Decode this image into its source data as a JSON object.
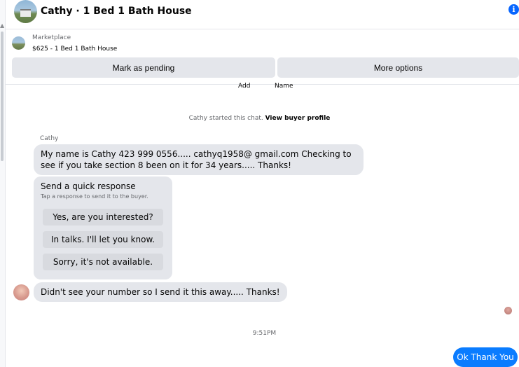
{
  "header": {
    "title": "Cathy · 1 Bed 1 Bath House",
    "info_icon": "i"
  },
  "listing": {
    "kicker": "Marketplace",
    "title": "$625 - 1 Bed 1 Bath House",
    "mark_pending_label": "Mark as pending",
    "more_options_label": "More options"
  },
  "partials": {
    "left": "Add",
    "right": "Name"
  },
  "system": {
    "started_text": "Cathy started this chat.",
    "view_profile_link": "View buyer profile"
  },
  "messages": {
    "sender_name": "Cathy",
    "first": "My name is Cathy 423 999 0556..... cathyq1958@ gmail.com Checking to see if you take section 8 been on it for 34 years..... Thanks!",
    "second": "Didn't see your number so I send it this away..... Thanks!",
    "timestamp": "9:51PM",
    "outgoing": "Ok Thank You"
  },
  "quick_response": {
    "title": "Send a quick response",
    "subtitle": "Tap a response to send it to the buyer.",
    "options": [
      "Yes, are you interested?",
      "In talks. I'll let you know.",
      "Sorry, it's not available."
    ]
  },
  "colors": {
    "accent": "#0866ff",
    "outgoing_bubble": "#0a7cff",
    "incoming_bubble": "#e4e6eb"
  }
}
